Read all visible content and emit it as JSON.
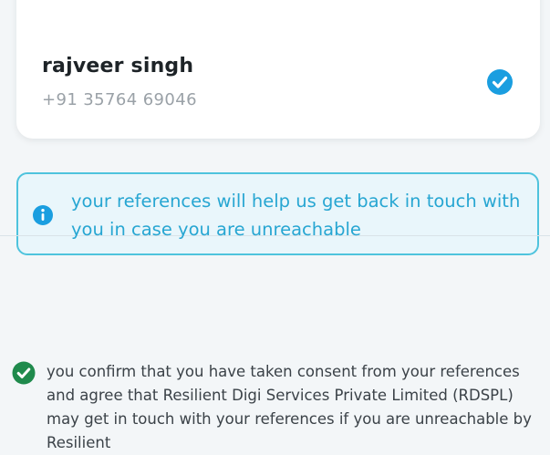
{
  "contact": {
    "name": "rajveer singh",
    "phone": "+91 35764 69046",
    "selected": true
  },
  "info_banner": {
    "text": "your references will help us get back in touch with you in case you are unreachable"
  },
  "consent": {
    "checked": true,
    "text": "you confirm that you have taken consent from your references and agree that Resilient Digi Services Private Limited (RDSPL) may get in touch with your references if you are unreachable by Resilient"
  },
  "colors": {
    "accent_blue": "#1a9ee0",
    "info_text": "#27a6d2",
    "info_border": "#4ec3dd",
    "consent_green": "#1f8a4c"
  },
  "icons": {
    "selected_check": "check-circle-icon",
    "info": "info-circle-icon",
    "consent_check": "check-circle-icon"
  }
}
